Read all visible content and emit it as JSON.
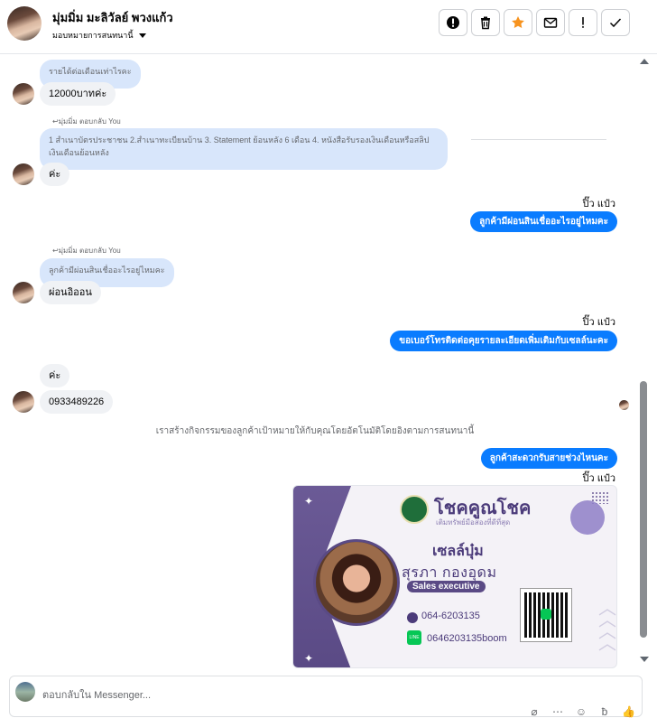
{
  "header": {
    "name": "มุ่มมิ่ม มะลิวัลย์ พวงแก้ว",
    "assign_label": "มอบหมายการสนทนานี้",
    "buttons": [
      "ทำเครื่องหมายว่าเป็นสแปม",
      "ลบ",
      "ติดดาว",
      "ทำเครื่องหมายว่ายังไม่ได้อ่าน",
      "ติดตามผล",
      "เสร็จสิ้น"
    ]
  },
  "messages": [
    {
      "type": "in-quoted",
      "text": "รายได้ต่อเดือนเท่าไรคะ"
    },
    {
      "type": "in",
      "text": "12000บาทค่ะ"
    },
    {
      "type": "reply-label",
      "text": "↩มุ่มมิ่ม ตอบกลับ You"
    },
    {
      "type": "in-quoted",
      "text": "1 สำเนาบัตรประชาชน 2.สำเนาทะเบียนบ้าน 3. Statement ย้อนหลัง 6 เดือน 4. หนังสือรับรองเงินเดือนหรือสลิปเงินเดือนย้อนหลัง"
    },
    {
      "type": "in",
      "text": "ค่ะ"
    },
    {
      "type": "sender",
      "text": "ปิ๊ว แป๋ว"
    },
    {
      "type": "out",
      "text": "ลูกค้ามีผ่อนสินเชื่ออะไรอยู่ไหมคะ"
    },
    {
      "type": "reply-label",
      "text": "↩มุ่มมิ่ม ตอบกลับ You"
    },
    {
      "type": "in-quoted",
      "text": "ลูกค้ามีผ่อนสินเชื่ออะไรอยู่ไหมคะ"
    },
    {
      "type": "in",
      "text": "ผ่อนอิออน"
    },
    {
      "type": "sender",
      "text": "ปิ๊ว แป๋ว"
    },
    {
      "type": "out",
      "text": "ขอเบอร์โทรติดต่อคุยรายละเอียดเพิ่มเติมกับเซลล์นะคะ"
    },
    {
      "type": "in",
      "text": "ค่ะ"
    },
    {
      "type": "in",
      "text": "0933489226"
    },
    {
      "type": "system",
      "text": "เราสร้างกิจกรรมของลูกค้าเป้าหมายให้กับคุณโดยอัตโนมัติโดยอิงตามการสนทนานี้"
    },
    {
      "type": "out",
      "text": "ลูกค้าสะดวกรับสายช่วงไหนคะ"
    },
    {
      "type": "sender",
      "text": "ปิ๊ว แป๋ว"
    }
  ],
  "business_card": {
    "brand": "โชคคูณโชค",
    "tagline": "เติมทรัพย์มือสองที่ดีที่สุด",
    "nickname": "เซลล์บุ๋ม",
    "full_name": "สุรภา   กองอุดม",
    "role": "Sales executive",
    "phone": "064-6203135",
    "line_id": "0646203135boom",
    "line_icon_text": "LINE"
  },
  "composer": {
    "placeholder": "ตอบกลับใน Messenger..."
  },
  "colors": {
    "accent": "#0a7cff",
    "incoming_bubble": "#dce9fc",
    "card_purple": "#5a4a85"
  }
}
